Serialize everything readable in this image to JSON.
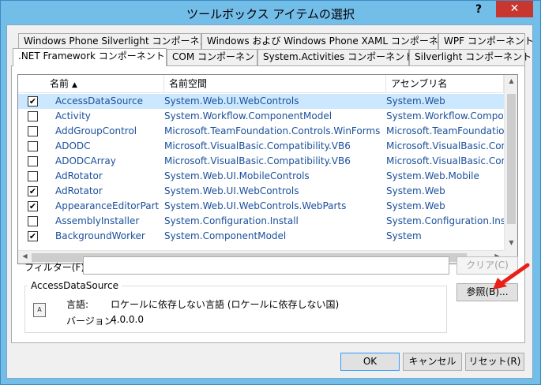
{
  "window": {
    "title": "ツールボックス アイテムの選択",
    "help": "?",
    "close": "✕"
  },
  "tabs_row1": [
    {
      "label": "Windows Phone Silverlight コンポーネント"
    },
    {
      "label": "Windows および Windows Phone XAML コンポーネント"
    },
    {
      "label": "WPF コンポーネント"
    }
  ],
  "tabs_row2": [
    {
      "label": ".NET Framework コンポーネント"
    },
    {
      "label": "COM コンポーネント"
    },
    {
      "label": "System.Activities コンポーネント"
    },
    {
      "label": "Silverlight コンポーネント"
    }
  ],
  "columns": {
    "name": "名前",
    "sort_indicator": "▲",
    "namespace": "名前空間",
    "assembly": "アセンブリ名"
  },
  "rows": [
    {
      "checked": true,
      "name": "AccessDataSource",
      "namespace": "System.Web.UI.WebControls",
      "assembly": "System.Web",
      "selected": true
    },
    {
      "checked": false,
      "name": "Activity",
      "namespace": "System.Workflow.ComponentModel",
      "assembly": "System.Workflow.Compo"
    },
    {
      "checked": false,
      "name": "AddGroupControl",
      "namespace": "Microsoft.TeamFoundation.Controls.WinForms",
      "assembly": "Microsoft.TeamFoundation"
    },
    {
      "checked": false,
      "name": "ADODC",
      "namespace": "Microsoft.VisualBasic.Compatibility.VB6",
      "assembly": "Microsoft.VisualBasic.Con"
    },
    {
      "checked": false,
      "name": "ADODCArray",
      "namespace": "Microsoft.VisualBasic.Compatibility.VB6",
      "assembly": "Microsoft.VisualBasic.Con"
    },
    {
      "checked": false,
      "name": "AdRotator",
      "namespace": "System.Web.UI.MobileControls",
      "assembly": "System.Web.Mobile"
    },
    {
      "checked": true,
      "name": "AdRotator",
      "namespace": "System.Web.UI.WebControls",
      "assembly": "System.Web"
    },
    {
      "checked": true,
      "name": "AppearanceEditorPart",
      "namespace": "System.Web.UI.WebControls.WebParts",
      "assembly": "System.Web"
    },
    {
      "checked": false,
      "name": "AssemblyInstaller",
      "namespace": "System.Configuration.Install",
      "assembly": "System.Configuration.Insta"
    },
    {
      "checked": true,
      "name": "BackgroundWorker",
      "namespace": "System.ComponentModel",
      "assembly": "System"
    }
  ],
  "filter": {
    "label": "フィルター(F):",
    "value": "",
    "clear_button": "クリア(C)"
  },
  "details": {
    "group_title": "AccessDataSource",
    "language_label": "言語:",
    "language_value": "ロケールに依存しない言語 (ロケールに依存しない国)",
    "version_label": "バージョン:",
    "version_value": "4.0.0.0",
    "icon_text": "A"
  },
  "browse_button": "参照(B)...",
  "buttons": {
    "ok": "OK",
    "cancel": "キャンセル",
    "reset": "リセット(R)"
  },
  "colors": {
    "titlebar": "#73bde9",
    "close": "#c7372f",
    "selection": "#cce8ff",
    "link_text": "#1a4f9c",
    "annotation_arrow": "#e8201a"
  }
}
